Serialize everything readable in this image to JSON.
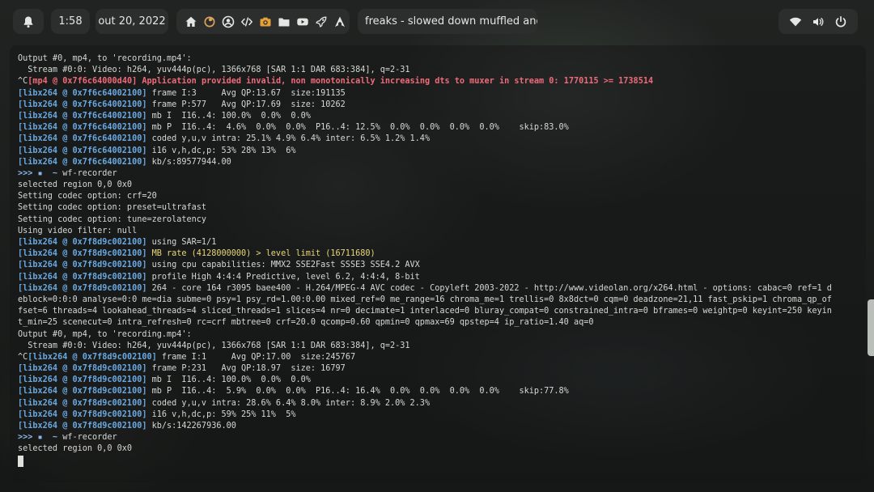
{
  "topbar": {
    "clock": "1:58",
    "date": "out 20, 2022",
    "media_title": "freaks  - slowed down muffled and echo",
    "app_icons": [
      "home-icon",
      "firefox-icon",
      "account-icon",
      "code-icon",
      "camera-icon",
      "folder-icon",
      "youtube-icon",
      "rocket-icon",
      "arch-icon"
    ],
    "system_icons": [
      "wifi-icon",
      "volume-icon",
      "power-icon"
    ]
  },
  "colors": {
    "accent_blue": "#6aa8e0",
    "error_red": "#f06a7a",
    "warning_yellow": "#e9d67a",
    "text": "#d6d8d4",
    "camera_orange": "#e8a13a"
  },
  "terminal": {
    "lines": [
      [
        {
          "t": "txt",
          "v": "Output #0, mp4, to 'recording.mp4':"
        }
      ],
      [
        {
          "t": "txt",
          "v": "  Stream #0:0: Video: h264, yuv444p(pc), 1366x768 [SAR 1:1 DAR 683:384], q=2-31"
        }
      ],
      [
        {
          "t": "txt",
          "v": "^C"
        },
        {
          "t": "err",
          "v": "[mp4 @ 0x7f6c64000d40] Application provided invalid, non monotonically increasing dts to muxer in stream 0: 1770115 >= 1738514"
        }
      ],
      [
        {
          "t": "tag",
          "v": "[libx264 @ 0x7f6c64002100]"
        },
        {
          "t": "txt",
          "v": " frame I:3     Avg QP:13.67  size:191135"
        }
      ],
      [
        {
          "t": "tag",
          "v": "[libx264 @ 0x7f6c64002100]"
        },
        {
          "t": "txt",
          "v": " frame P:577   Avg QP:17.69  size: 10262"
        }
      ],
      [
        {
          "t": "tag",
          "v": "[libx264 @ 0x7f6c64002100]"
        },
        {
          "t": "txt",
          "v": " mb I  I16..4: 100.0%  0.0%  0.0%"
        }
      ],
      [
        {
          "t": "tag",
          "v": "[libx264 @ 0x7f6c64002100]"
        },
        {
          "t": "txt",
          "v": " mb P  I16..4:  4.6%  0.0%  0.0%  P16..4: 12.5%  0.0%  0.0%  0.0%  0.0%    skip:83.0%"
        }
      ],
      [
        {
          "t": "tag",
          "v": "[libx264 @ 0x7f6c64002100]"
        },
        {
          "t": "txt",
          "v": " coded y,u,v intra: 25.1% 4.9% 6.4% inter: 6.5% 1.2% 1.4%"
        }
      ],
      [
        {
          "t": "tag",
          "v": "[libx264 @ 0x7f6c64002100]"
        },
        {
          "t": "txt",
          "v": " i16 v,h,dc,p: 53% 28% 13%  6%"
        }
      ],
      [
        {
          "t": "tag",
          "v": "[libx264 @ 0x7f6c64002100]"
        },
        {
          "t": "txt",
          "v": " kb/s:89577944.00"
        }
      ],
      [
        {
          "t": "prompt",
          "v": ">>> ▪  ~ "
        },
        {
          "t": "txt",
          "v": "wf-recorder"
        }
      ],
      [
        {
          "t": "txt",
          "v": "selected region 0,0 0x0"
        }
      ],
      [
        {
          "t": "txt",
          "v": "Setting codec option: crf=20"
        }
      ],
      [
        {
          "t": "txt",
          "v": "Setting codec option: preset=ultrafast"
        }
      ],
      [
        {
          "t": "txt",
          "v": "Setting codec option: tune=zerolatency"
        }
      ],
      [
        {
          "t": "txt",
          "v": "Using video filter: null"
        }
      ],
      [
        {
          "t": "tag",
          "v": "[libx264 @ 0x7f8d9c002100]"
        },
        {
          "t": "txt",
          "v": " using SAR=1/1"
        }
      ],
      [
        {
          "t": "tag",
          "v": "[libx264 @ 0x7f8d9c002100]"
        },
        {
          "t": "warn",
          "v": " MB rate (4128000000) > level limit (16711680)"
        }
      ],
      [
        {
          "t": "tag",
          "v": "[libx264 @ 0x7f8d9c002100]"
        },
        {
          "t": "txt",
          "v": " using cpu capabilities: MMX2 SSE2Fast SSSE3 SSE4.2 AVX"
        }
      ],
      [
        {
          "t": "tag",
          "v": "[libx264 @ 0x7f8d9c002100]"
        },
        {
          "t": "txt",
          "v": " profile High 4:4:4 Predictive, level 6.2, 4:4:4, 8-bit"
        }
      ],
      [
        {
          "t": "tag",
          "v": "[libx264 @ 0x7f8d9c002100]"
        },
        {
          "t": "txt",
          "v": " 264 - core 164 r3095 baee400 - H.264/MPEG-4 AVC codec - Copyleft 2003-2022 - http://www.videolan.org/x264.html - options: cabac=0 ref=1 d"
        }
      ],
      [
        {
          "t": "txt",
          "v": "eblock=0:0:0 analyse=0:0 me=dia subme=0 psy=1 psy_rd=1.00:0.00 mixed_ref=0 me_range=16 chroma_me=1 trellis=0 8x8dct=0 cqm=0 deadzone=21,11 fast_pskip=1 chroma_qp_of"
        }
      ],
      [
        {
          "t": "txt",
          "v": "fset=6 threads=4 lookahead_threads=4 sliced_threads=1 slices=4 nr=0 decimate=1 interlaced=0 bluray_compat=0 constrained_intra=0 bframes=0 weightp=0 keyint=250 keyin"
        }
      ],
      [
        {
          "t": "txt",
          "v": "t_min=25 scenecut=0 intra_refresh=0 rc=crf mbtree=0 crf=20.0 qcomp=0.60 qpmin=0 qpmax=69 qpstep=4 ip_ratio=1.40 aq=0"
        }
      ],
      [
        {
          "t": "txt",
          "v": "Output #0, mp4, to 'recording.mp4':"
        }
      ],
      [
        {
          "t": "txt",
          "v": "  Stream #0:0: Video: h264, yuv444p(pc), 1366x768 [SAR 1:1 DAR 683:384], q=2-31"
        }
      ],
      [
        {
          "t": "txt",
          "v": "^C"
        },
        {
          "t": "tag",
          "v": "[libx264 @ 0x7f8d9c002100]"
        },
        {
          "t": "txt",
          "v": " frame I:1     Avg QP:17.00  size:245767"
        }
      ],
      [
        {
          "t": "tag",
          "v": "[libx264 @ 0x7f8d9c002100]"
        },
        {
          "t": "txt",
          "v": " frame P:231   Avg QP:18.97  size: 16797"
        }
      ],
      [
        {
          "t": "tag",
          "v": "[libx264 @ 0x7f8d9c002100]"
        },
        {
          "t": "txt",
          "v": " mb I  I16..4: 100.0%  0.0%  0.0%"
        }
      ],
      [
        {
          "t": "tag",
          "v": "[libx264 @ 0x7f8d9c002100]"
        },
        {
          "t": "txt",
          "v": " mb P  I16..4:  5.9%  0.0%  0.0%  P16..4: 16.4%  0.0%  0.0%  0.0%  0.0%    skip:77.8%"
        }
      ],
      [
        {
          "t": "tag",
          "v": "[libx264 @ 0x7f8d9c002100]"
        },
        {
          "t": "txt",
          "v": " coded y,u,v intra: 28.6% 6.4% 8.0% inter: 8.9% 2.0% 2.3%"
        }
      ],
      [
        {
          "t": "tag",
          "v": "[libx264 @ 0x7f8d9c002100]"
        },
        {
          "t": "txt",
          "v": " i16 v,h,dc,p: 59% 25% 11%  5%"
        }
      ],
      [
        {
          "t": "tag",
          "v": "[libx264 @ 0x7f8d9c002100]"
        },
        {
          "t": "txt",
          "v": " kb/s:142267936.00"
        }
      ],
      [
        {
          "t": "prompt",
          "v": ">>> ▪  ~ "
        },
        {
          "t": "txt",
          "v": "wf-recorder"
        }
      ],
      [
        {
          "t": "txt",
          "v": "selected region 0,0 0x0"
        }
      ]
    ]
  }
}
